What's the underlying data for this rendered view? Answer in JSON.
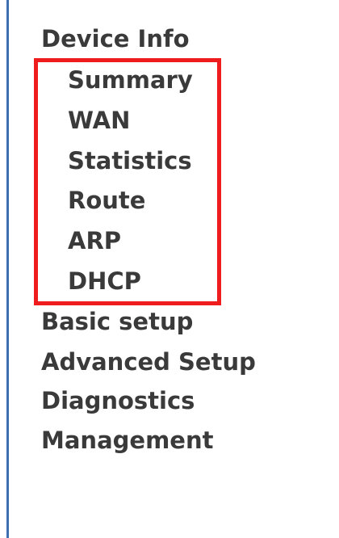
{
  "nav": {
    "device_info": "Device Info",
    "sub_items": [
      "Summary",
      "WAN",
      "Statistics",
      "Route",
      "ARP",
      "DHCP"
    ],
    "basic_setup": "Basic setup",
    "advanced_setup": "Advanced Setup",
    "diagnostics": "Diagnostics",
    "management": "Management"
  },
  "colors": {
    "text": "#3a3a3a",
    "highlight_border": "#ee1c1c",
    "left_border": "#3f6fb3",
    "background": "#ffffff"
  }
}
